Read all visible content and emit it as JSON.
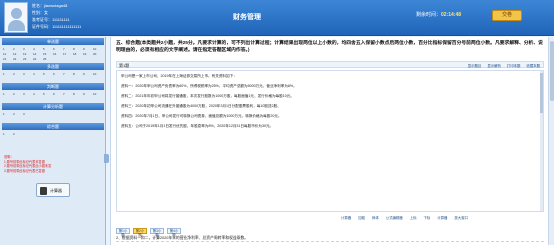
{
  "header": {
    "candidate": [
      "姓名：jiaowulaga48",
      "性别：女",
      "准考证号：111111111",
      "证件号码：111111111111111"
    ],
    "title": "财务管理",
    "timer_label": "剩余时间：",
    "timer_value": "02:14:48",
    "submit_label": "交卷"
  },
  "sidebar": {
    "section1": "单选题",
    "section2": "多选题",
    "section3": "判断题",
    "section4": "计算分析题",
    "section5": "综合题",
    "grid1": [
      "1",
      "2",
      "3",
      "4",
      "5",
      "6",
      "7",
      "8",
      "9",
      "10",
      "11",
      "12",
      "13",
      "14",
      "15",
      "16",
      "17",
      "18",
      "19",
      "20",
      "21",
      "22",
      "23",
      "24",
      "25"
    ],
    "grid2": [
      "1",
      "2",
      "3",
      "4",
      "5",
      "6",
      "7",
      "8",
      "9",
      "10"
    ],
    "grid3": [
      "1",
      "2",
      "3",
      "4",
      "5",
      "6",
      "7",
      "8",
      "9",
      "10"
    ],
    "grid4": [
      "1",
      "2",
      "3"
    ],
    "grid5": [
      "1",
      "2"
    ],
    "notes": [
      "说明：",
      "1.题号前带此标记代表未答题",
      "2.题号前带此标记代表此小题未答",
      "3.题号前带此标记代表已答题"
    ],
    "calc_label": "计算器"
  },
  "main": {
    "question_title": "五、综合题(本类题共2小题，共25分。凡要求计算的，可不列出计算过程；计算结果出现两位以上小数的，均四舍五入保留小数点后两位小数，百分比指标保留百分号前两位小数。凡要求解释、分析、说明理由的，必须有相应的文字阐述。请在指定答题区域内作答。)",
    "case_label": "第1题",
    "case_tools": [
      "显示题目",
      "显示解析",
      "打印本题",
      "收藏本题"
    ],
    "material": [
      "甲公司是一家上市公司，2019年在上海证券交易所上市。有关资料如下：",
      "资料一：2020年甲公司资产负债率为60%，所得税税率为25%，平均资产总额为5000万元，营业净利率为8%。",
      "资料二：2021年年初甲公司将发行普通股，本次发行股数为1000万股，每股面值1元，发行价格为每股10元。",
      "资料三：2020年初甲公司流通在外普通股为4000万股，2020年3月1日分配股票股利，每10股送2股。",
      "资料四：2020年7月1日，甲公司发行可转换公司债券，面值总额为1000万元，转换价格为每股20元。",
      "资料五：公司于2019年1月1日发行优先股，年股息率为8%，2020年12月31日每股市价为30元。"
    ],
    "editor_tools": [
      "计算器",
      "加粗",
      "斜体",
      "公式编辑器",
      "上标",
      "下标",
      "计算器",
      "放大窗口"
    ],
    "sub_tabs": [
      "第1小题",
      "第2小题",
      "第3小题",
      "第4小题"
    ],
    "sub_question": "2、根据资料一和二，计算2020年末的营业净利率、总资产周转率和权益乘数。"
  }
}
